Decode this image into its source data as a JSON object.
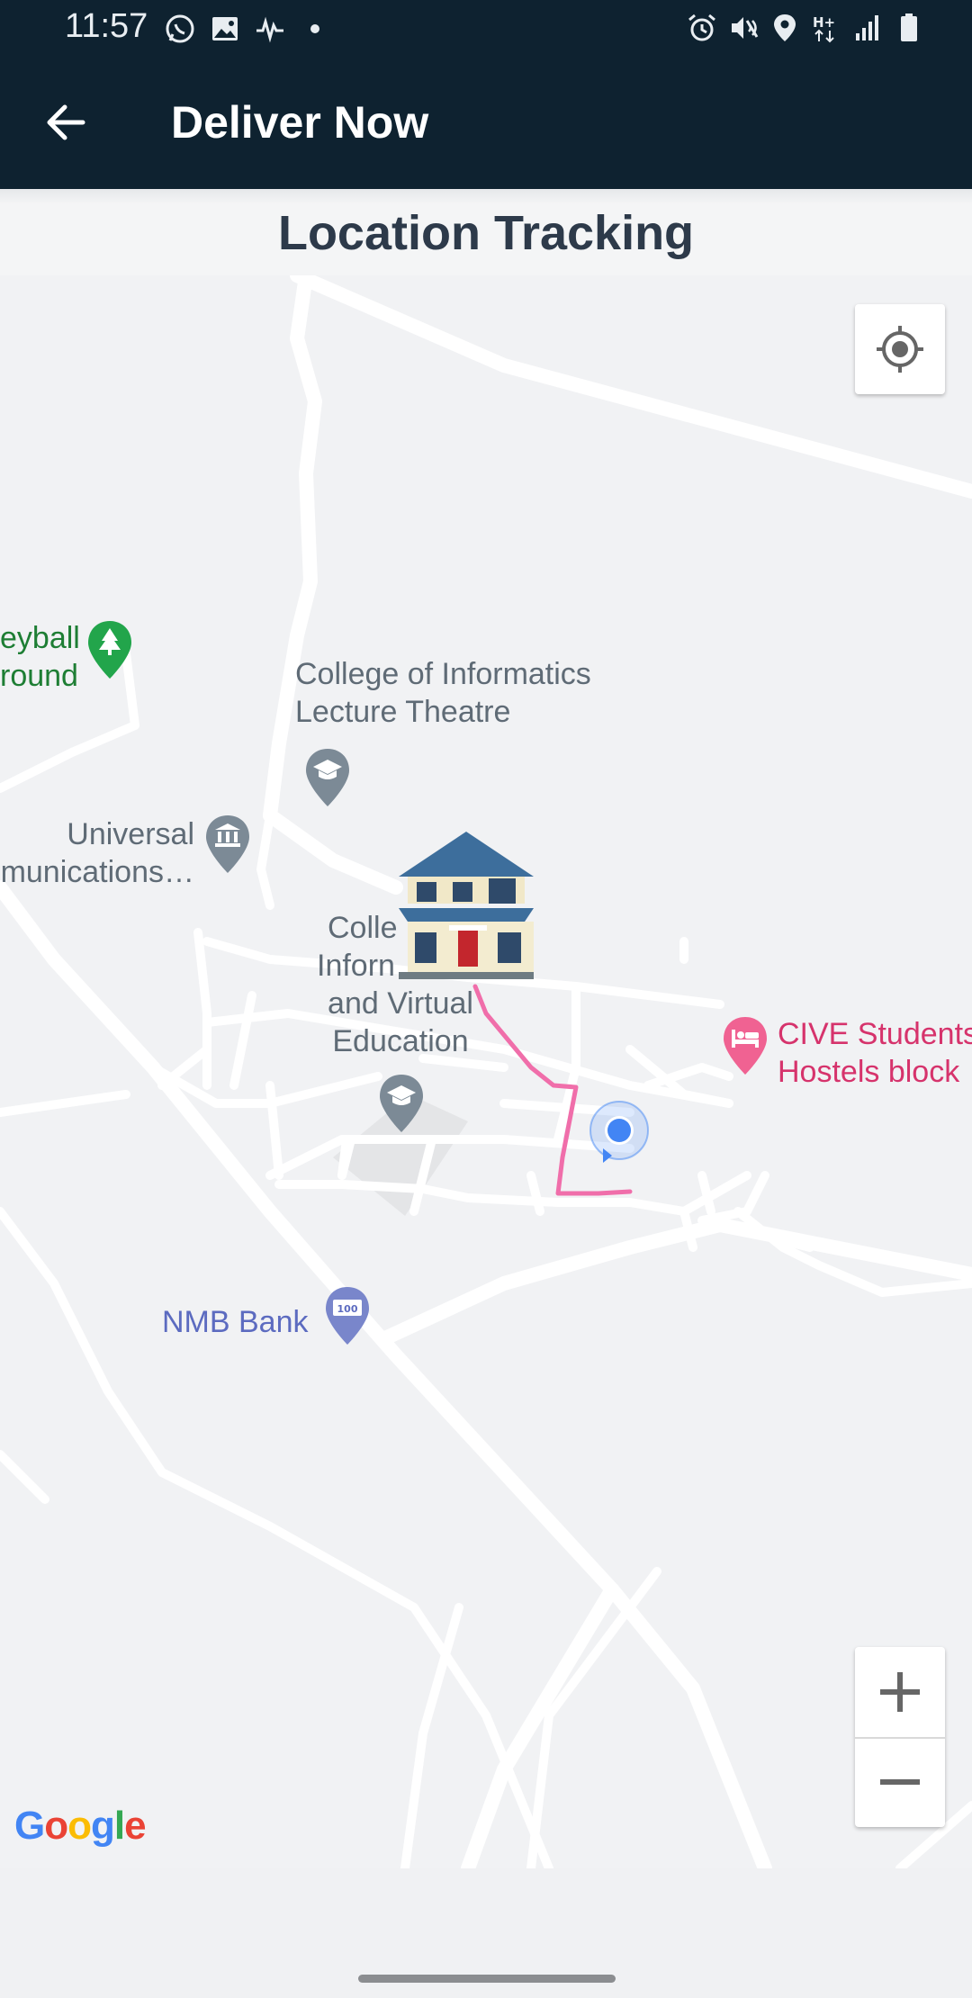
{
  "status_bar": {
    "time": "11:57",
    "left_icons": [
      "whatsapp-icon",
      "gallery-icon",
      "activity-icon",
      "dot-icon"
    ],
    "right_icons": [
      "alarm-icon",
      "mute-icon",
      "location-icon",
      "network-h-plus-icon",
      "signal-icon",
      "battery-icon"
    ]
  },
  "app_bar": {
    "title": "Deliver Now",
    "back_icon": "arrow-left-icon"
  },
  "section_title": "Location Tracking",
  "map": {
    "provider_logo": [
      "G",
      "o",
      "o",
      "g",
      "l",
      "e"
    ],
    "logo_colors": [
      "#4285F4",
      "#EA4335",
      "#FBBC05",
      "#4285F4",
      "#34A853",
      "#EA4335"
    ],
    "route_color": "#f06eaa",
    "user_dot_color": "#4285f4",
    "pois": [
      {
        "lines": [
          "eyball",
          "round"
        ],
        "icon": "park-icon",
        "color": "#1e7e34"
      },
      {
        "lines": [
          "College of Informatics",
          "Lecture Theatre"
        ],
        "icon": "graduation-cap-icon",
        "color": "#5f6b76"
      },
      {
        "lines": [
          "Universal",
          "munications…"
        ],
        "icon": "museum-icon",
        "color": "#5f6b76"
      },
      {
        "lines": [
          "Colle",
          "Inforn",
          "and Virtual",
          "Education"
        ],
        "icon": "graduation-cap-icon",
        "color": "#5f6b76"
      },
      {
        "lines": [
          "CIVE Students",
          "Hostels block"
        ],
        "icon": "hotel-bed-icon",
        "color": "#d6336c"
      },
      {
        "lines": [
          "NMB Bank"
        ],
        "icon": "atm-icon",
        "color": "#5c6bc0"
      }
    ],
    "controls": {
      "my_location_icon": "crosshair-icon",
      "zoom_in": "+",
      "zoom_out": "−"
    },
    "destination_marker": "house-icon"
  }
}
